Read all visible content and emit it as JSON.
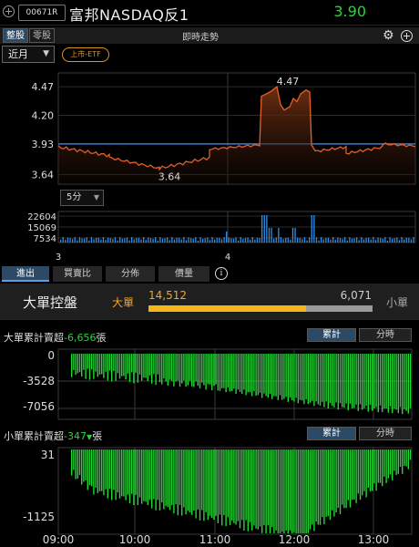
{
  "header": {
    "code": "00671R",
    "title": "富邦NASDAQ反1",
    "price": "3.90"
  },
  "subbar": {
    "tab_whole": "整股",
    "tab_odd": "零股",
    "title": "即時走勢"
  },
  "controls": {
    "period": "近月",
    "badge": "上市-ETF",
    "interval": "5分"
  },
  "price_chart": {
    "y_ticks": [
      "4.47",
      "4.20",
      "3.93",
      "3.64"
    ],
    "max_label": "4.47",
    "min_label": "3.64",
    "reference": 3.93,
    "ylim": [
      3.55,
      4.6
    ]
  },
  "volume_chart": {
    "y_ticks": [
      "22604",
      "15069",
      "7534"
    ],
    "x_labels": [
      "3",
      "4"
    ]
  },
  "tabs": [
    "進出",
    "買賣比",
    "分佈",
    "價量"
  ],
  "control": {
    "title": "大單控盤",
    "big_label": "大單",
    "small_label": "小單",
    "big_value": "14,512",
    "small_value": "6,071",
    "big_ratio": 0.705
  },
  "big_section": {
    "title_prefix": "大單累計賣超",
    "value": "-6,656",
    "unit": "張",
    "toggle_cum": "累計",
    "toggle_time": "分時",
    "y_ticks": [
      "0",
      "-3528",
      "-7056"
    ]
  },
  "small_section": {
    "title_prefix": "小單累計賣超",
    "value": "-347",
    "unit": "張",
    "toggle_cum": "累計",
    "toggle_time": "分時",
    "y_ticks": [
      "31",
      "-1125"
    ]
  },
  "time_axis": [
    "09:00",
    "10:00",
    "11:00",
    "12:00",
    "13:00"
  ],
  "colors": {
    "up": "#24d636",
    "accent": "#f5a623",
    "line": "#e2602a",
    "ref": "#2f7fd0",
    "volume": "#2f8fe6",
    "bars": "#24d636"
  }
}
